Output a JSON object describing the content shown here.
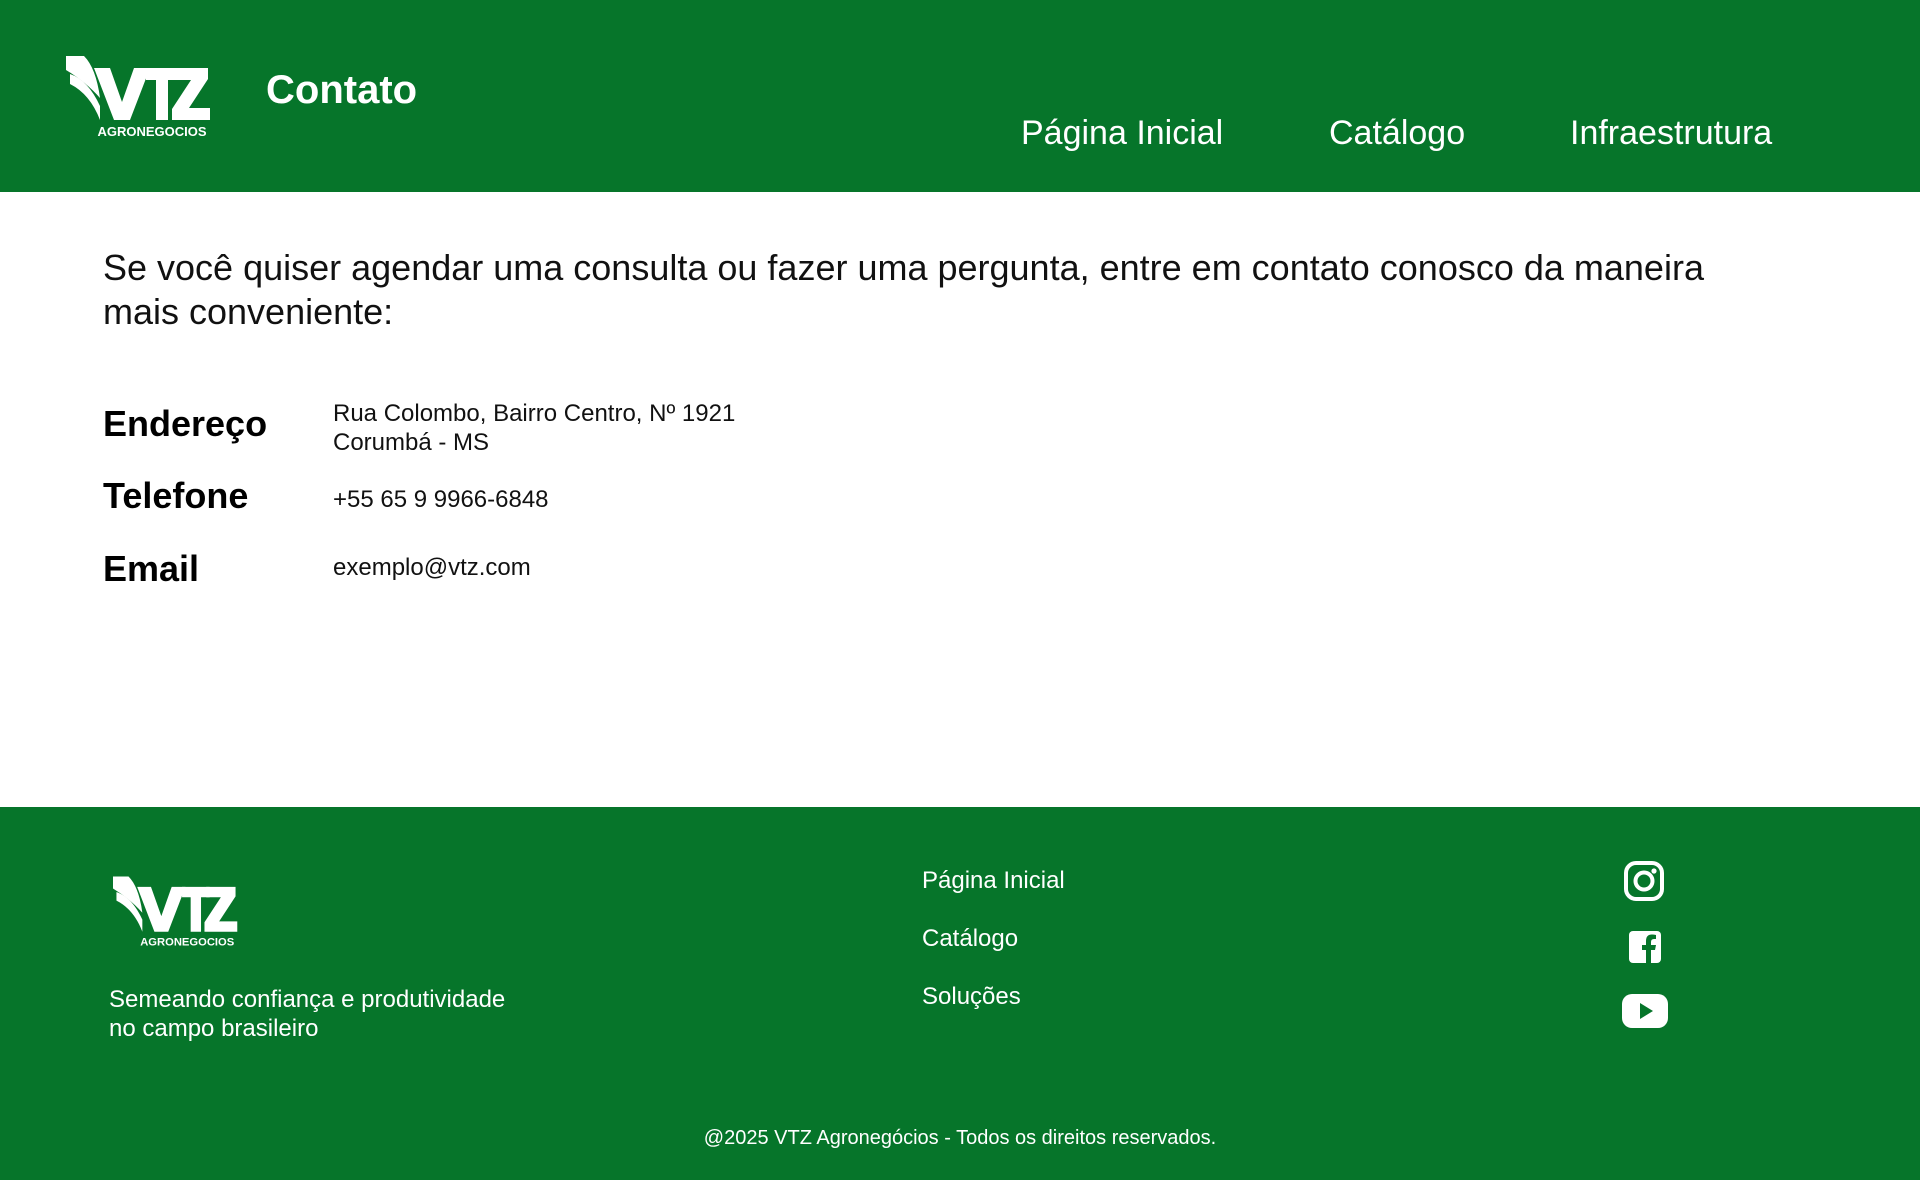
{
  "header": {
    "logo": {
      "mark": "VTZ",
      "sub": "AGRONEGOCIOS"
    },
    "title": "Contato",
    "nav": [
      {
        "label": "Página Inicial"
      },
      {
        "label": "Catálogo"
      },
      {
        "label": "Infraestrutura"
      }
    ]
  },
  "main": {
    "intro_line1": "Se você quiser agendar uma consulta ou fazer uma pergunta, entre em contato conosco da maneira",
    "intro_line2": "mais conveniente:",
    "contacts": [
      {
        "label": "Endereço",
        "value_line1": "Rua Colombo, Bairro Centro, Nº 1921",
        "value_line2": "Corumbá - MS"
      },
      {
        "label": "Telefone",
        "value_line1": "+55 65 9 9966-6848"
      },
      {
        "label": "Email",
        "value_line1": "exemplo@vtz.com"
      }
    ]
  },
  "footer": {
    "logo": {
      "mark": "VTZ",
      "sub": "AGRONEGOCIOS"
    },
    "tagline_line1": "Semeando confiança e produtividade",
    "tagline_line2": "no campo brasileiro",
    "links": [
      {
        "label": "Página Inicial"
      },
      {
        "label": "Catálogo"
      },
      {
        "label": "Soluções"
      }
    ],
    "social": [
      {
        "icon": "instagram-icon"
      },
      {
        "icon": "facebook-icon"
      },
      {
        "icon": "youtube-icon"
      }
    ],
    "copyright": "@2025 VTZ Agronegócios - Todos os direitos reservados."
  },
  "colors": {
    "brand_green": "#06752a",
    "text_white": "#ffffff",
    "text_dark": "#111111"
  }
}
